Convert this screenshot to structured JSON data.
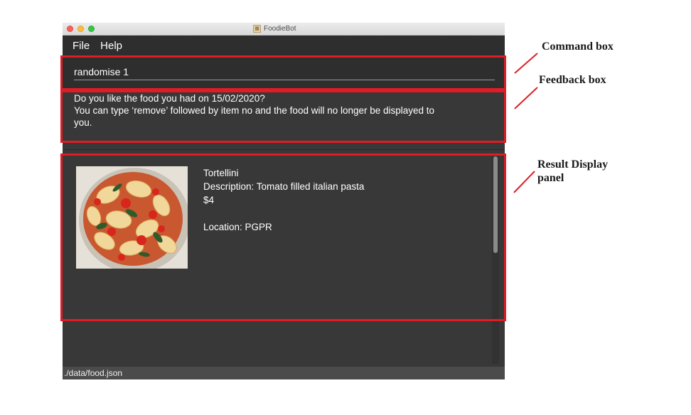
{
  "window": {
    "title": "FoodieBot"
  },
  "menu": {
    "file": "File",
    "help": "Help"
  },
  "command_box": {
    "value": "randomise 1"
  },
  "feedback": {
    "line1": "Do you like the food you had on 15/02/2020?",
    "line2": "You can type ‘remove’ followed by item no and the food will no longer be displayed to",
    "line3": "you."
  },
  "result": {
    "name": "Tortellini",
    "description": "Description: Tomato filled italian pasta",
    "price": "$4",
    "location": "Location: PGPR"
  },
  "status_bar": {
    "path": "./data/food.json"
  },
  "annotations": {
    "command_box": "Command box",
    "feedback_box": "Feedback box",
    "result_line1": "Result Display",
    "result_line2": "panel",
    "highlight_color": "#e01c24"
  }
}
